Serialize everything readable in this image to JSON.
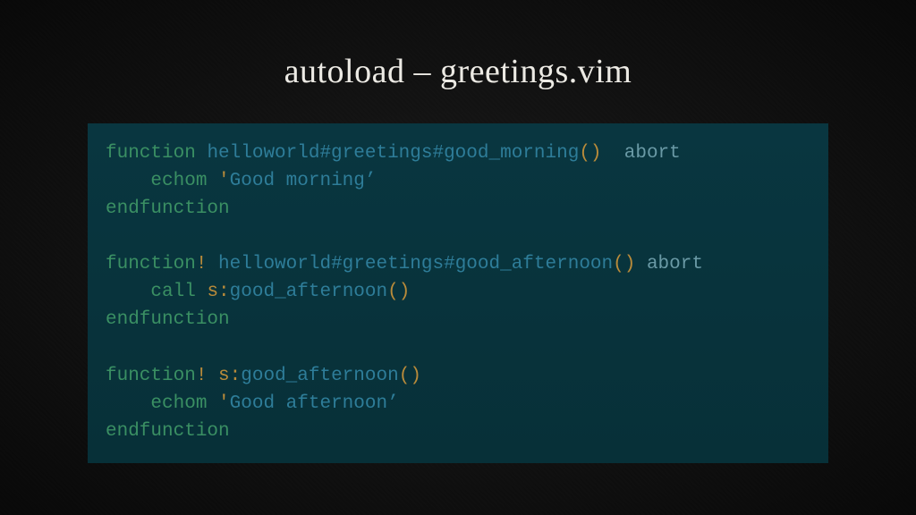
{
  "title": "autoload – greetings.vim",
  "code": {
    "l1": {
      "kw": "function",
      "sp1": " ",
      "fn": "helloworld#greetings#good_morning",
      "lp": "(",
      "rp": ")",
      "sp2": "  ",
      "abort": "abort"
    },
    "l2": {
      "indent": "    ",
      "kw": "echom",
      "sp": " ",
      "q1": "'",
      "str": "Good morning",
      "q2": "’"
    },
    "l3": {
      "kw": "endfunction"
    },
    "l4": "",
    "l5": {
      "kw": "function",
      "ex": "!",
      "sp1": " ",
      "fn": "helloworld#greetings#good_afternoon",
      "lp": "(",
      "rp": ")",
      "sp2": " ",
      "abort": "abort"
    },
    "l6": {
      "indent": "    ",
      "kw": "call",
      "sp": " ",
      "scope": "s:",
      "fn": "good_afternoon",
      "lp": "(",
      "rp": ")"
    },
    "l7": {
      "kw": "endfunction"
    },
    "l8": "",
    "l9": {
      "kw": "function",
      "ex": "!",
      "sp1": " ",
      "scope": "s:",
      "fn": "good_afternoon",
      "lp": "(",
      "rp": ")"
    },
    "l10": {
      "indent": "    ",
      "kw": "echom",
      "sp": " ",
      "q1": "'",
      "str": "Good afternoon",
      "q2": "’"
    },
    "l11": {
      "kw": "endfunction"
    }
  }
}
